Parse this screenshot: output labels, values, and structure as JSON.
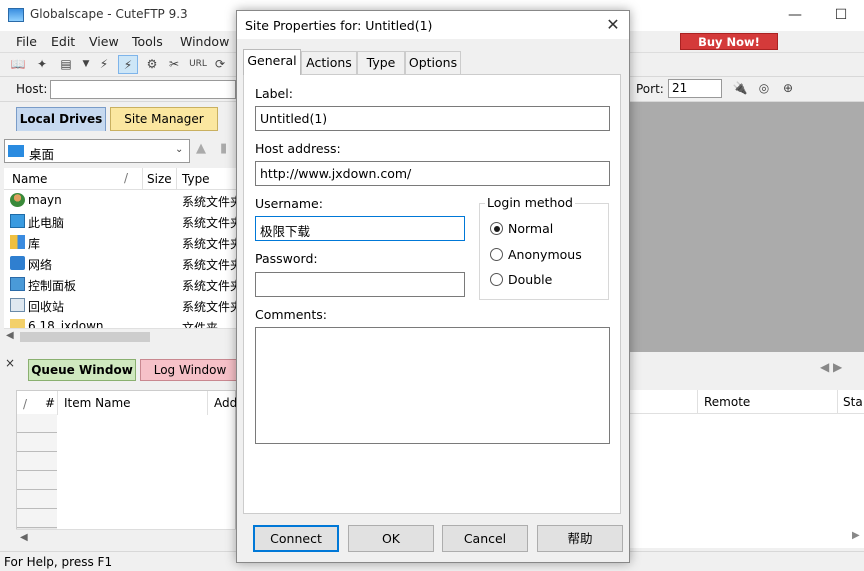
{
  "app": {
    "title": "Globalscape - CuteFTP 9.3",
    "buy_now": "Buy Now!",
    "menu": [
      "File",
      "Edit",
      "View",
      "Tools",
      "Window"
    ],
    "host_label": "Host:",
    "port_label": "Port:",
    "port_value": "21"
  },
  "left_pane": {
    "tabs": [
      "Local Drives",
      "Site Manager"
    ],
    "drive": "桌面",
    "columns": [
      "Name",
      "/",
      "Size",
      "Type"
    ],
    "files": [
      {
        "name": "mayn",
        "type": "系统文件夹"
      },
      {
        "name": "此电脑",
        "type": "系统文件夹"
      },
      {
        "name": "库",
        "type": "系统文件夹"
      },
      {
        "name": "网络",
        "type": "系统文件夹"
      },
      {
        "name": "控制面板",
        "type": "系统文件夹"
      },
      {
        "name": "回收站",
        "type": "系统文件夹"
      },
      {
        "name": "6.18_jxdown",
        "type": "文件夹"
      }
    ]
  },
  "queue": {
    "tabs": [
      "Queue Window",
      "Log Window"
    ],
    "columns": [
      "/",
      "#",
      "Item Name",
      "Add"
    ]
  },
  "remote": {
    "columns": [
      "Remote",
      "Sta"
    ]
  },
  "status": "For Help, press F1",
  "dialog": {
    "title": "Site Properties for: Untitled(1)",
    "tabs": [
      "General",
      "Actions",
      "Type",
      "Options"
    ],
    "label_caption": "Label:",
    "label_value": "Untitled(1)",
    "host_caption": "Host address:",
    "host_value": "http://www.jxdown.com/",
    "username_caption": "Username:",
    "username_value": "极限下载",
    "password_caption": "Password:",
    "password_value": "",
    "comments_caption": "Comments:",
    "comments_value": "",
    "login_method": {
      "caption": "Login method",
      "options": [
        "Normal",
        "Anonymous",
        "Double"
      ],
      "selected": "Normal"
    },
    "buttons": [
      "Connect",
      "OK",
      "Cancel",
      "帮助"
    ]
  },
  "colors": {
    "buy_now": "#d43a3a",
    "local_tab": "#c6d9f0",
    "site_tab": "#fbe7a0",
    "queue_tab": "#cfe8bf",
    "log_tab": "#f6c1c8",
    "focus": "#0078d7"
  }
}
